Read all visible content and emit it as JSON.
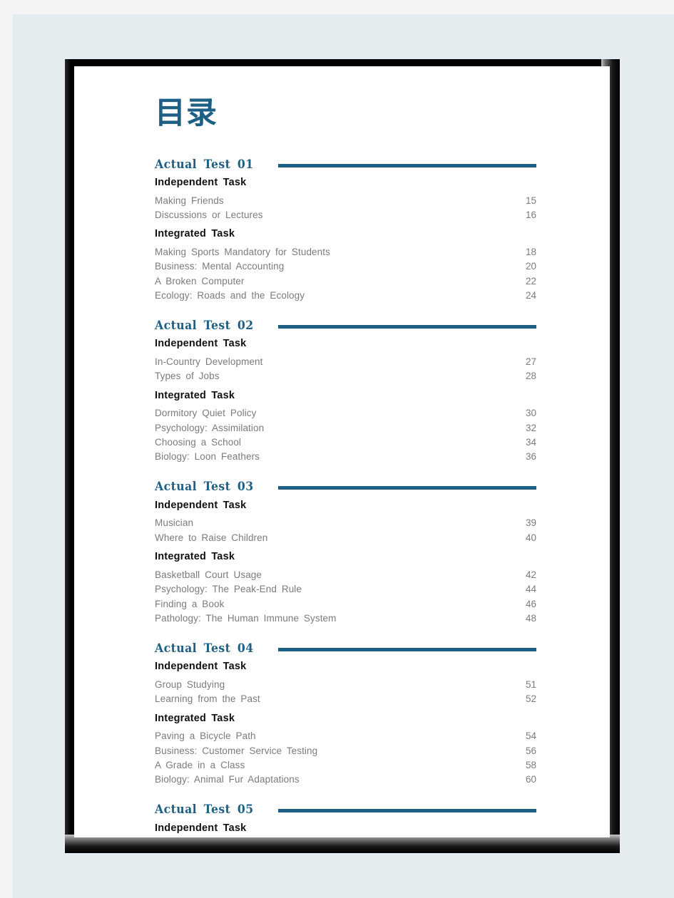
{
  "document": {
    "title": "目录",
    "accent_color": "#1d5f85",
    "entry_text_color": "#7b7b7b",
    "heading_text_color": "#111111",
    "page_background": "#ffffff",
    "canvas_background": "#e4ecef",
    "frame_color": "#000000"
  },
  "sections": [
    {
      "label": "Actual Test 01",
      "groups": [
        {
          "label": "Independent Task",
          "entries": [
            {
              "title": "Making Friends",
              "page": "15"
            },
            {
              "title": "Discussions or Lectures",
              "page": "16"
            }
          ]
        },
        {
          "label": "Integrated Task",
          "entries": [
            {
              "title": "Making Sports Mandatory for Students",
              "page": "18"
            },
            {
              "title": "Business: Mental Accounting",
              "page": "20"
            },
            {
              "title": "A Broken Computer",
              "page": "22"
            },
            {
              "title": "Ecology: Roads and the Ecology",
              "page": "24"
            }
          ]
        }
      ]
    },
    {
      "label": "Actual Test 02",
      "groups": [
        {
          "label": "Independent Task",
          "entries": [
            {
              "title": "In-Country Development",
              "page": "27"
            },
            {
              "title": "Types of Jobs",
              "page": "28"
            }
          ]
        },
        {
          "label": "Integrated Task",
          "entries": [
            {
              "title": "Dormitory Quiet Policy",
              "page": "30"
            },
            {
              "title": "Psychology: Assimilation",
              "page": "32"
            },
            {
              "title": "Choosing a School",
              "page": "34"
            },
            {
              "title": "Biology: Loon Feathers",
              "page": "36"
            }
          ]
        }
      ]
    },
    {
      "label": "Actual Test 03",
      "groups": [
        {
          "label": "Independent Task",
          "entries": [
            {
              "title": "Musician",
              "page": "39"
            },
            {
              "title": "Where to Raise Children",
              "page": "40"
            }
          ]
        },
        {
          "label": "Integrated Task",
          "entries": [
            {
              "title": "Basketball Court Usage",
              "page": "42"
            },
            {
              "title": "Psychology: The Peak-End Rule",
              "page": "44"
            },
            {
              "title": "Finding a Book",
              "page": "46"
            },
            {
              "title": "Pathology: The Human Immune System",
              "page": "48"
            }
          ]
        }
      ]
    },
    {
      "label": "Actual Test 04",
      "groups": [
        {
          "label": "Independent Task",
          "entries": [
            {
              "title": "Group Studying",
              "page": "51"
            },
            {
              "title": "Learning from the Past",
              "page": "52"
            }
          ]
        },
        {
          "label": "Integrated Task",
          "entries": [
            {
              "title": "Paving a Bicycle Path",
              "page": "54"
            },
            {
              "title": "Business: Customer Service Testing",
              "page": "56"
            },
            {
              "title": "A Grade in a Class",
              "page": "58"
            },
            {
              "title": "Biology: Animal Fur Adaptations",
              "page": "60"
            }
          ]
        }
      ]
    },
    {
      "label": "Actual Test 05",
      "groups": [
        {
          "label": "Independent Task",
          "entries": []
        }
      ]
    }
  ]
}
